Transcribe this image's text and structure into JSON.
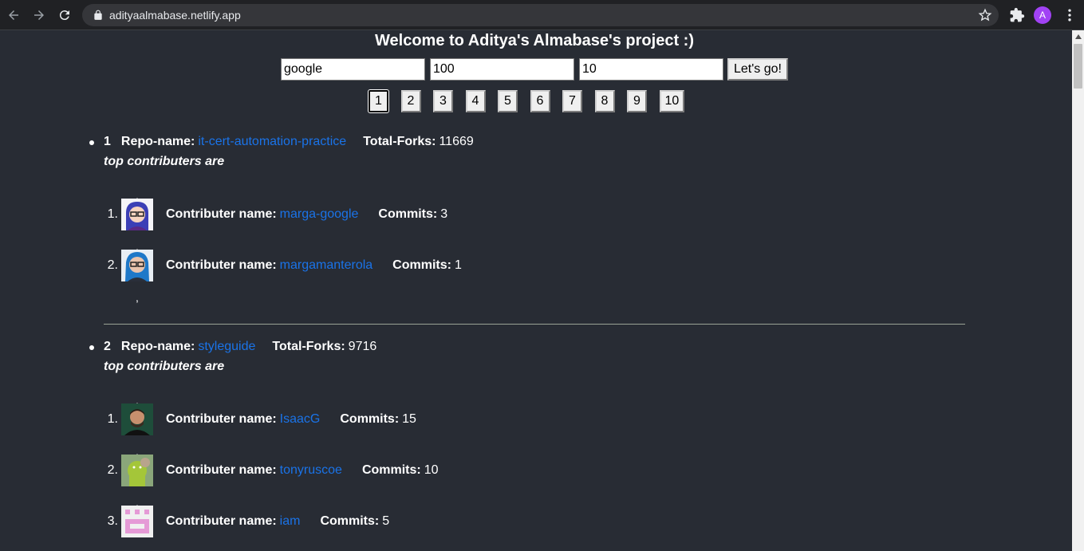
{
  "browser": {
    "url": "adityaalmabase.netlify.app",
    "profile_initial": "A"
  },
  "page": {
    "title": "Welcome to Aditya's Almabase's project :)",
    "org_input": "google",
    "repo_count_input": "100",
    "contrib_count_input": "10",
    "go_label": "Let's go!",
    "pages": [
      "1",
      "2",
      "3",
      "4",
      "5",
      "6",
      "7",
      "8",
      "9",
      "10"
    ],
    "active_page": "1"
  },
  "labels": {
    "repo_name": "Repo-name:",
    "total_forks": "Total-Forks:",
    "top_contributers": "top contributers are",
    "contributer_name": "Contributer name:",
    "commits": "Commits:",
    "comma": ","
  },
  "repos": [
    {
      "index": "1",
      "name": "it-cert-automation-practice",
      "forks": "11669",
      "contributors": [
        {
          "num": "1.",
          "name": "marga-google",
          "commits": "3",
          "avatar": "avatar-purple"
        },
        {
          "num": "2.",
          "name": "margamanterola",
          "commits": "1",
          "avatar": "avatar-blue"
        }
      ]
    },
    {
      "index": "2",
      "name": "styleguide",
      "forks": "9716",
      "contributors": [
        {
          "num": "1.",
          "name": "IsaacG",
          "commits": "15",
          "avatar": "avatar-photo-dark"
        },
        {
          "num": "2.",
          "name": "tonyruscoe",
          "commits": "10",
          "avatar": "avatar-photo-android"
        },
        {
          "num": "3.",
          "name": "iam",
          "commits": "5",
          "avatar": "avatar-identicon-pink"
        }
      ]
    }
  ]
}
